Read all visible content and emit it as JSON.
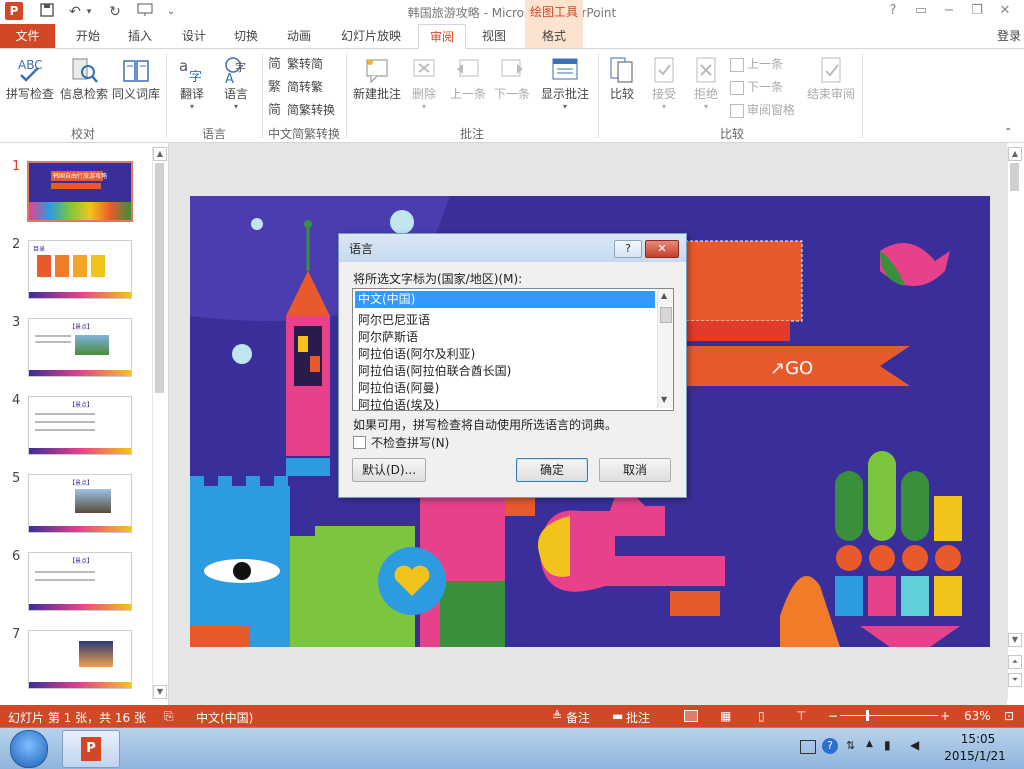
{
  "titlebar": {
    "title": "韩国旅游攻略 - Microsoft PowerPoint",
    "context_tool": "绘图工具",
    "qat_extra": "⌄"
  },
  "tabs": {
    "file": "文件",
    "home": "开始",
    "insert": "插入",
    "design": "设计",
    "transitions": "切换",
    "animations": "动画",
    "slideshow": "幻灯片放映",
    "review": "审阅",
    "view": "视图",
    "format": "格式",
    "login": "登录"
  },
  "ribbon": {
    "spell": "拼写检查",
    "research": "信息检索",
    "thesaurus": "同义词库",
    "proofing_group": "校对",
    "translate": "翻译",
    "language": "语言",
    "language_group": "语言",
    "trad2simp": "繁转简",
    "simp2trad": "简转繁",
    "convert": "简繁转换",
    "chinese_group": "中文简繁转换",
    "new_comment": "新建批注",
    "delete": "删除",
    "prev": "上一条",
    "next": "下一条",
    "show_comments": "显示批注",
    "comments_group": "批注",
    "compare": "比较",
    "accept": "接受",
    "reject": "拒绝",
    "prev_small": "上一条",
    "next_small": "下一条",
    "review_pane": "审阅窗格",
    "end_review": "结束审阅",
    "compare_group": "比较"
  },
  "slides": {
    "numbers": [
      "1",
      "2",
      "3",
      "4",
      "5",
      "6",
      "7"
    ],
    "title1": "韩国自由行旅游攻略",
    "tag": "【景点】",
    "heading2": "目录"
  },
  "slide": {
    "go": "↗GO"
  },
  "dialog": {
    "title": "语言",
    "help": "?",
    "close": "✕",
    "prompt": "将所选文字标为(国家/地区)(M):",
    "items": [
      "中文(中国)",
      "阿尔巴尼亚语",
      "阿尔萨斯语",
      "阿拉伯语(阿尔及利亚)",
      "阿拉伯语(阿拉伯联合酋长国)",
      "阿拉伯语(阿曼)",
      "阿拉伯语(埃及)"
    ],
    "note": "如果可用，拼写检查将自动使用所选语言的词典。",
    "checkbox": "不检查拼写(N)",
    "default_btn": "默认(D)...",
    "ok_btn": "确定",
    "cancel_btn": "取消"
  },
  "status": {
    "slide_info": "幻灯片 第 1 张，共 16 张",
    "lang": "中文(中国)",
    "notes": "备注",
    "comments": "批注",
    "zoom": "63%"
  },
  "taskbar": {
    "time": "15:05",
    "date": "2015/1/21"
  },
  "colors": {
    "accent": "#d24726",
    "slide_bg": "#3a2f9a",
    "selection": "#3399ff"
  }
}
